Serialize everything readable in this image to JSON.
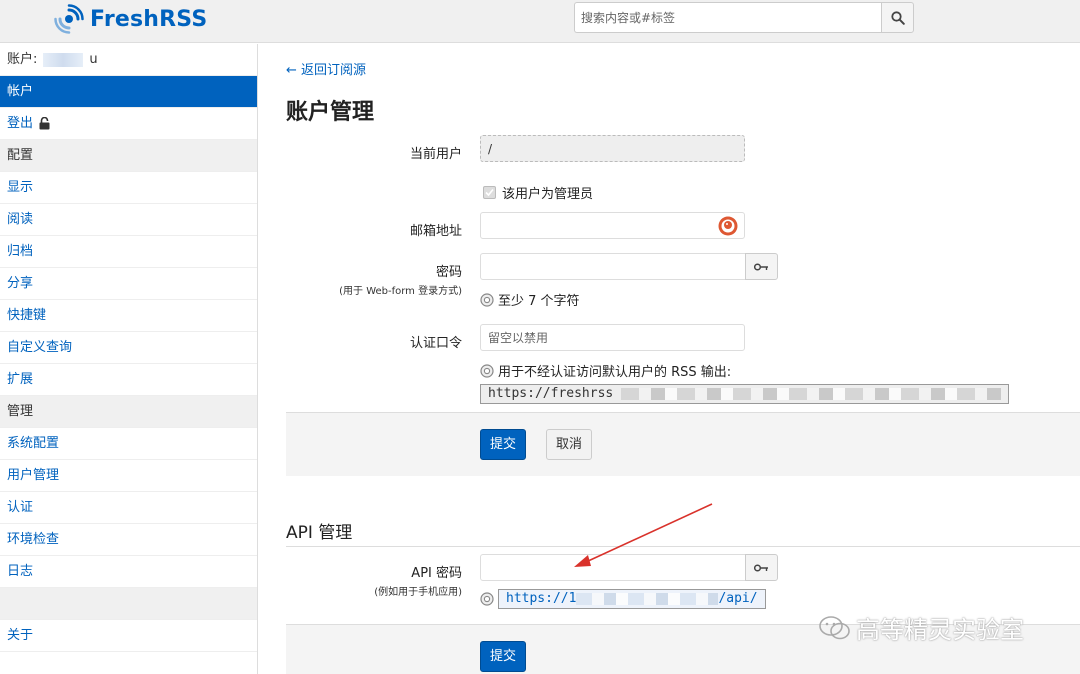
{
  "app": {
    "name": "FreshRSS",
    "brand_color": "#0062be"
  },
  "search": {
    "placeholder": "搜索内容或#标签",
    "icon": "search-icon"
  },
  "sidebar": {
    "account_label": "账户:",
    "account_suffix": "u",
    "items": [
      {
        "label": "帐户",
        "type": "active"
      },
      {
        "label": "登出",
        "type": "link",
        "icon": "lock-icon"
      },
      {
        "label": "配置",
        "type": "section"
      },
      {
        "label": "显示",
        "type": "link"
      },
      {
        "label": "阅读",
        "type": "link"
      },
      {
        "label": "归档",
        "type": "link"
      },
      {
        "label": "分享",
        "type": "link"
      },
      {
        "label": "快捷键",
        "type": "link"
      },
      {
        "label": "自定义查询",
        "type": "link"
      },
      {
        "label": "扩展",
        "type": "link"
      },
      {
        "label": "管理",
        "type": "section"
      },
      {
        "label": "系统配置",
        "type": "link"
      },
      {
        "label": "用户管理",
        "type": "link"
      },
      {
        "label": "认证",
        "type": "link"
      },
      {
        "label": "环境检查",
        "type": "link"
      },
      {
        "label": "日志",
        "type": "link"
      },
      {
        "label": "",
        "type": "empty"
      },
      {
        "label": "关于",
        "type": "link"
      }
    ]
  },
  "main": {
    "back_link": "← 返回订阅源",
    "title": "账户管理",
    "current_user_label": "当前用户",
    "current_user_value": "/",
    "is_admin_label": "该用户为管理员",
    "email_label": "邮箱地址",
    "password_label": "密码",
    "password_sub": "(用于 Web-form 登录方式)",
    "password_help": "至少 7 个字符",
    "token_label": "认证口令",
    "token_placeholder": "留空以禁用",
    "token_help": "用于不经认证访问默认用户的 RSS 输出:",
    "token_url": "https://freshrss",
    "submit_label": "提交",
    "cancel_label": "取消"
  },
  "api": {
    "title": "API 管理",
    "password_label": "API 密码",
    "password_sub": "(例如用于手机应用)",
    "url_prefix": "https://1",
    "url_suffix": "/api/",
    "submit_label": "提交"
  },
  "overlay": {
    "watermark_text": "高等精灵实验室",
    "arrow_color": "#d9322b"
  }
}
